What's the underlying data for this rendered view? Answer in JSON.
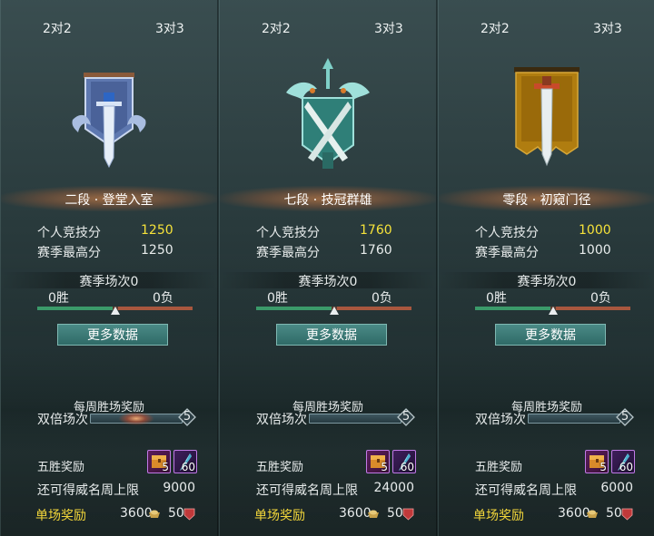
{
  "panels": [
    {
      "tabs": {
        "left": "2对2",
        "right": "3对3"
      },
      "emblem_icon": "blue-banner-sword-emblem-icon",
      "rank_name": "二段 · 登堂入室",
      "personal_score_label": "个人竞技分",
      "personal_score": "1250",
      "season_high_label": "赛季最高分",
      "season_high": "1250",
      "season_matches": "赛季场次0",
      "wins": "0胜",
      "losses": "0负",
      "win_ratio": 0.5,
      "more_data": "更多数据",
      "weekly_title": "每周胜场奖励",
      "double_label": "双倍场次",
      "double_count": "5",
      "five_win_label": "五胜奖励",
      "reward_chest_count": "5",
      "reward_gem_count": "60",
      "weekly_cap_label": "还可得威名周上限",
      "weekly_cap": "9000",
      "single_label": "单场奖励",
      "single_coin": "3600",
      "single_badge": "50"
    },
    {
      "tabs": {
        "left": "2对2",
        "right": "3对3"
      },
      "emblem_icon": "crossed-swords-crest-emblem-icon",
      "rank_name": "七段 · 技冠群雄",
      "personal_score_label": "个人竞技分",
      "personal_score": "1760",
      "season_high_label": "赛季最高分",
      "season_high": "1760",
      "season_matches": "赛季场次0",
      "wins": "0胜",
      "losses": "0负",
      "win_ratio": 0.5,
      "more_data": "更多数据",
      "weekly_title": "每周胜场奖励",
      "double_label": "双倍场次",
      "double_count": "5",
      "five_win_label": "五胜奖励",
      "reward_chest_count": "5",
      "reward_gem_count": "60",
      "weekly_cap_label": "还可得威名周上限",
      "weekly_cap": "24000",
      "single_label": "单场奖励",
      "single_coin": "3600",
      "single_badge": "50"
    },
    {
      "tabs": {
        "left": "2对2",
        "right": "3对3"
      },
      "emblem_icon": "gold-banner-sword-emblem-icon",
      "rank_name": "零段 · 初窥门径",
      "personal_score_label": "个人竞技分",
      "personal_score": "1000",
      "season_high_label": "赛季最高分",
      "season_high": "1000",
      "season_matches": "赛季场次0",
      "wins": "0胜",
      "losses": "0负",
      "win_ratio": 0.5,
      "more_data": "更多数据",
      "weekly_title": "每周胜场奖励",
      "double_label": "双倍场次",
      "double_count": "5",
      "five_win_label": "五胜奖励",
      "reward_chest_count": "5",
      "reward_gem_count": "60",
      "weekly_cap_label": "还可得威名周上限",
      "weekly_cap": "6000",
      "single_label": "单场奖励",
      "single_coin": "3600",
      "single_badge": "50"
    }
  ],
  "colors": {
    "highlight": "#f5e23a",
    "win_bar": "#3b9a6a",
    "loss_bar": "#a8573e",
    "button": "#3a7a76"
  }
}
